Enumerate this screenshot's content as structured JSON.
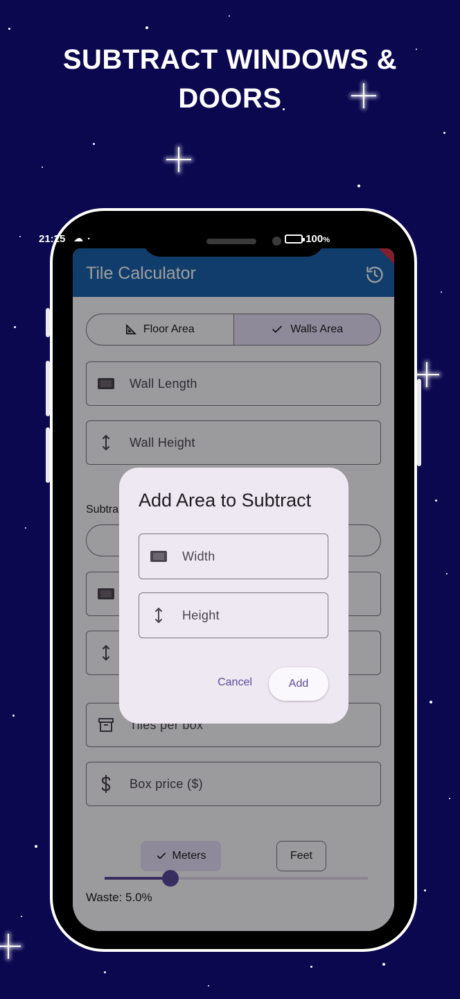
{
  "headline": {
    "line1": "SUBTRACT WINDOWS &",
    "line2": "DOORS"
  },
  "status_bar": {
    "time": "21:25",
    "battery_value": "100",
    "battery_unit": "%"
  },
  "app_bar": {
    "title": "Tile Calculator",
    "history_icon": "history-icon"
  },
  "segmented": {
    "items": [
      {
        "label": "Floor Area",
        "icon": "set-square-icon",
        "selected": false
      },
      {
        "label": "Walls Area",
        "icon": "check-icon",
        "selected": true
      }
    ]
  },
  "fields": {
    "wall_length": "Wall Length",
    "wall_height": "Wall Height",
    "tiles_per_box": "Tiles per box",
    "box_price": "Box price ($)"
  },
  "subtract_label": "Subtra",
  "units": {
    "meters": "Meters",
    "feet": "Feet",
    "selected": "Meters"
  },
  "waste": {
    "label": "Waste: 5.0%",
    "value_percent": 5.0,
    "slider_fraction": 0.25
  },
  "dialog": {
    "title": "Add Area to Subtract",
    "width_label": "Width",
    "height_label": "Height",
    "cancel": "Cancel",
    "add": "Add"
  },
  "colors": {
    "background": "#0b0850",
    "app_bar": "#1a63ad",
    "accent": "#5b4a9b",
    "selected_segment": "#e7dff8",
    "dialog": "#eee8f2"
  }
}
